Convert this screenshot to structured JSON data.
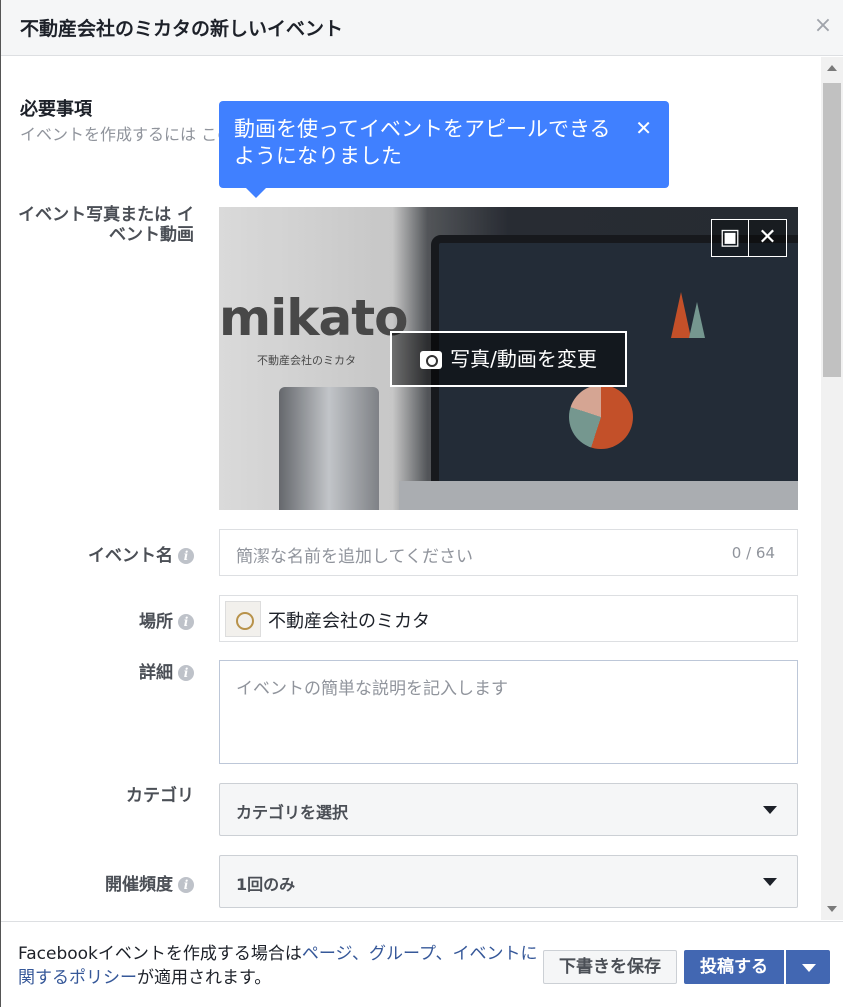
{
  "dialog": {
    "title": "不動産会社のミカタの新しいイベント",
    "close_icon": "×"
  },
  "requirements": {
    "title": "必要事項",
    "description": "イベントを作成するには このイベ ト向けに作成した広告に"
  },
  "tooltip": {
    "text": "動画を使ってイベントをアピールできるようになりました",
    "close": "✕"
  },
  "photo": {
    "label": "イベント写真または イベント動画",
    "change_label": "写真/動画を変更",
    "logo_text": "mikato",
    "logo_sub": "不動産会社のミカタ",
    "tool_reposition_icon": "image-reposition-icon",
    "tool_remove": "✕"
  },
  "event_name": {
    "label": "イベント名",
    "placeholder": "簡潔な名前を追加してください",
    "counter": "0 / 64"
  },
  "place": {
    "label": "場所",
    "value": "不動産会社のミカタ"
  },
  "details": {
    "label": "詳細",
    "placeholder": "イベントの簡単な説明を記入します"
  },
  "category": {
    "label": "カテゴリ",
    "value": "カテゴリを選択"
  },
  "frequency": {
    "label": "開催頻度",
    "value": "1回のみ"
  },
  "footer": {
    "text_pre": "Facebookイベントを作成する場合は",
    "link": "ページ、グループ、イベントに関するポリシー",
    "text_post": "が適用されます。",
    "save_draft": "下書きを保存",
    "post": "投稿する"
  },
  "colors": {
    "primary": "#4267b2",
    "tooltip": "#4080ff",
    "link": "#365899"
  }
}
